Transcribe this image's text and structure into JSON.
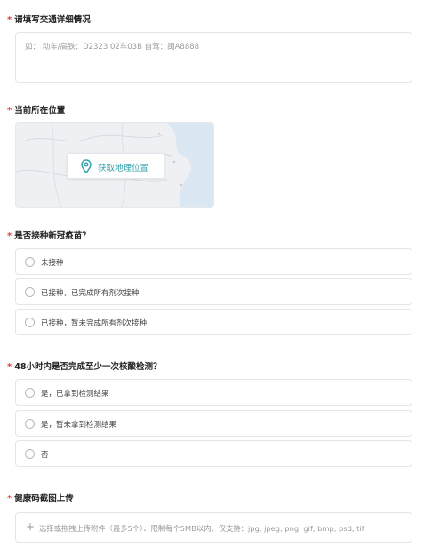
{
  "required_mark": "*",
  "transport": {
    "title": "请填写交通详细情况",
    "placeholder": "如：  动车/高铁：D2323  02车03B 自驾：闽A8888"
  },
  "location": {
    "title": "当前所在位置",
    "button_label": "获取地理位置",
    "icon": "location-pin-icon",
    "accent_color": "#2f9fa9"
  },
  "vaccine": {
    "title": "是否接种新冠疫苗？",
    "options": [
      "未接种",
      "已接种，已完成所有剂次接种",
      "已接种，暂未完成所有剂次接种"
    ]
  },
  "nucleic_test": {
    "title": "48小时内是否完成至少一次核酸检测？",
    "options": [
      "是，已拿到检测结果",
      "是，暂未拿到检测结果",
      "否"
    ]
  },
  "health_code": {
    "title": "健康码截图上传",
    "upload_label": "选择或拖拽上传附件（最多5个）、限制每个5MB以内、仅支持：jpg, jpeg, png, gif, bmp, psd, tif",
    "icon": "plus-icon"
  },
  "colors": {
    "required": "#e8413d",
    "border": "#e5e5e5",
    "placeholder": "#9b9b9b"
  }
}
